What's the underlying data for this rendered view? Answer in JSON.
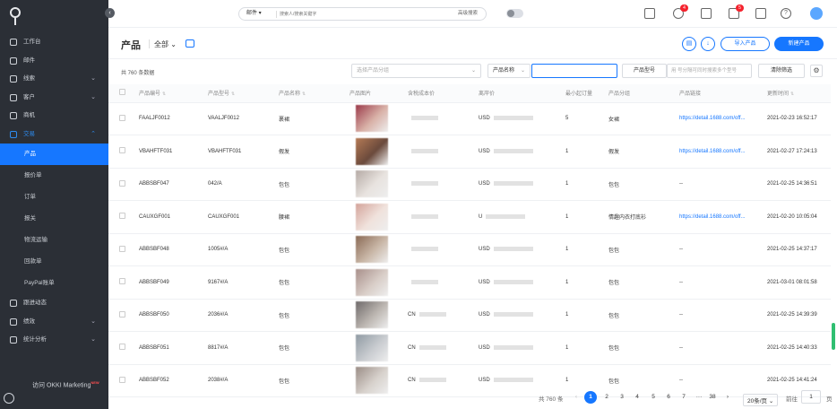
{
  "sidebar": {
    "items": [
      {
        "label": "工作台",
        "chevron": ""
      },
      {
        "label": "邮件",
        "chevron": ""
      },
      {
        "label": "线索",
        "chevron": "⌄"
      },
      {
        "label": "客户",
        "chevron": "⌄"
      },
      {
        "label": "商机",
        "chevron": ""
      },
      {
        "label": "交易",
        "chevron": "⌃"
      }
    ],
    "subitems": [
      "产品",
      "报价单",
      "订单",
      "报关",
      "物流运输",
      "回款单",
      "PayPal账单"
    ],
    "items2": [
      {
        "label": "跟进动态",
        "chevron": ""
      },
      {
        "label": "绩效",
        "chevron": "⌄"
      },
      {
        "label": "统计分析",
        "chevron": "⌄"
      }
    ],
    "visit_label": "访问 OKKI Marketing",
    "visit_badge": "NEW"
  },
  "topbar": {
    "search_type": "邮件 ▾",
    "search_placeholder": "搜索人/搜索关键字",
    "search_button": "高级搜索",
    "badges": [
      "4",
      "5"
    ]
  },
  "header": {
    "title": "产品",
    "view": "全部 ⌄",
    "import_label": "导入产品",
    "new_label": "新建产品"
  },
  "filters": {
    "total": "共 760 条数据",
    "category_placeholder": "选择产品分组",
    "field_select": "产品名称",
    "model_label": "产品型号",
    "model_placeholder": "用 号分隔可同时搜索多个型号",
    "clear_label": "清除筛选"
  },
  "table": {
    "headers": [
      "产品编号",
      "产品型号",
      "产品名称",
      "产品图片",
      "含税成本价",
      "离岸价",
      "最小起订量",
      "产品分组",
      "产品链接",
      "更新时间"
    ],
    "rows": [
      {
        "code": "FAALJF0012",
        "model": "VAALJF0012",
        "name": "裹裙",
        "cost_prefix": "",
        "price_prefix": "USD",
        "moq": "5",
        "group": "女裙",
        "link": "https://detail.1688.com/off...",
        "updated": "2021-02-23 16:52:17"
      },
      {
        "code": "VBAHFTF031",
        "model": "VBAHFTF031",
        "name": "假发",
        "cost_prefix": "",
        "price_prefix": "USD",
        "moq": "1",
        "group": "假发",
        "link": "https://detail.1688.com/off...",
        "updated": "2021-02-27 17:24:13"
      },
      {
        "code": "ABBSBF047",
        "model": "042/A",
        "name": "包包",
        "cost_prefix": "",
        "price_prefix": "USD",
        "moq": "1",
        "group": "包包",
        "link": "--",
        "updated": "2021-02-25 14:36:51"
      },
      {
        "code": "CAUXGF001",
        "model": "CAUXGF001",
        "name": "腰裙",
        "cost_prefix": "",
        "price_prefix": "U",
        "moq": "1",
        "group": "情趣内衣打底衫",
        "link": "https://detail.1688.com/off...",
        "updated": "2021-02-20 10:05:04"
      },
      {
        "code": "ABBSBF048",
        "model": "1005#/A",
        "name": "包包",
        "cost_prefix": "",
        "price_prefix": "USD",
        "moq": "1",
        "group": "包包",
        "link": "--",
        "updated": "2021-02-25 14:37:17"
      },
      {
        "code": "ABBSBF049",
        "model": "9167#/A",
        "name": "包包",
        "cost_prefix": "",
        "price_prefix": "USD",
        "moq": "1",
        "group": "包包",
        "link": "--",
        "updated": "2021-03-01 08:01:58"
      },
      {
        "code": "ABBSBF050",
        "model": "2036#/A",
        "name": "包包",
        "cost_prefix": "CN",
        "price_prefix": "USD",
        "moq": "1",
        "group": "包包",
        "link": "--",
        "updated": "2021-02-25 14:39:39"
      },
      {
        "code": "ABBSBF051",
        "model": "8817#/A",
        "name": "包包",
        "cost_prefix": "CN",
        "price_prefix": "USD",
        "moq": "1",
        "group": "包包",
        "link": "--",
        "updated": "2021-02-25 14:40:33"
      },
      {
        "code": "ABBSBF052",
        "model": "2038#/A",
        "name": "包包",
        "cost_prefix": "CN",
        "price_prefix": "USD",
        "moq": "1",
        "group": "包包",
        "link": "--",
        "updated": "2021-02-25 14:41:24"
      }
    ]
  },
  "pager": {
    "total": "共 760 条",
    "pages": [
      "1",
      "2",
      "3",
      "4",
      "5",
      "6",
      "7",
      "···",
      "38"
    ],
    "page_size": "20条/页",
    "goto_label": "前往",
    "goto_value": "1",
    "goto_suffix": "页"
  }
}
